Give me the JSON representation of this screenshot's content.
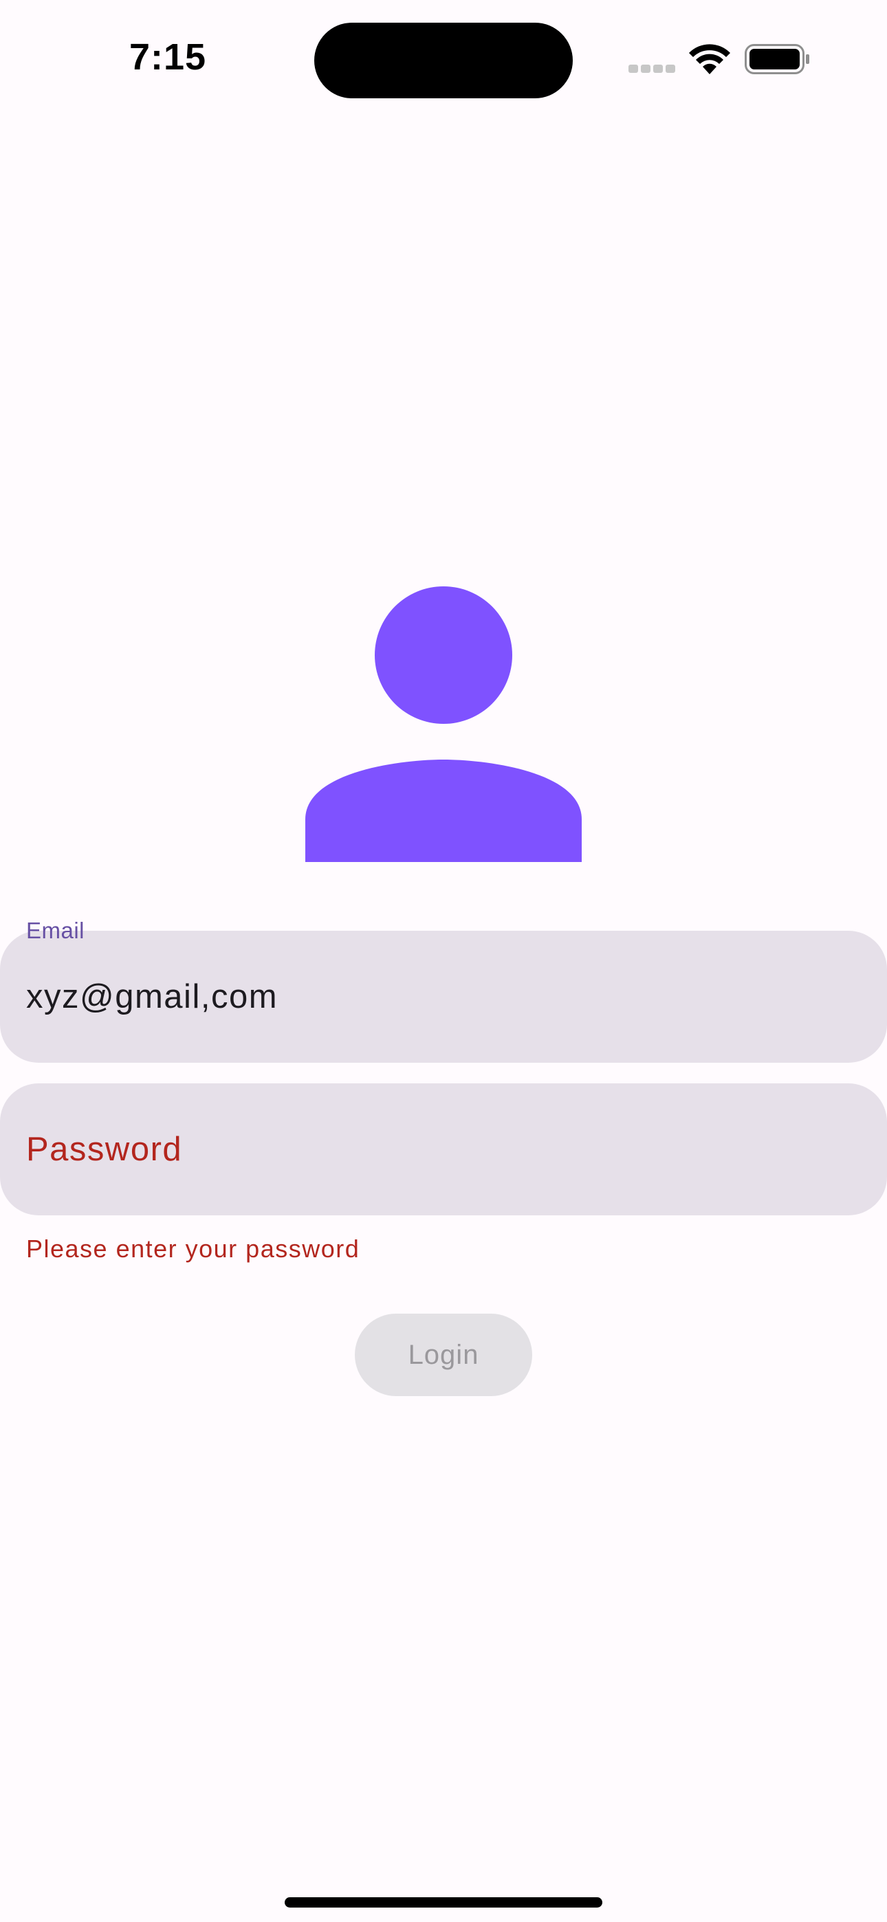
{
  "status_bar": {
    "time": "7:15",
    "signal_icon": "cellular-signal-icon",
    "wifi_icon": "wifi-icon",
    "battery_icon": "battery-icon"
  },
  "avatar": {
    "icon": "person-icon",
    "color": "#7f52ff"
  },
  "login_form": {
    "email": {
      "label": "Email",
      "value": "xyz@gmail,com"
    },
    "password": {
      "placeholder": "Password",
      "error": "Please enter your password"
    },
    "submit_label": "Login"
  },
  "colors": {
    "background": "#fffbfe",
    "field_fill": "#e6e0e9",
    "label_accent": "#6750a4",
    "error": "#b3261e",
    "disabled_button": "#e3e1e5"
  }
}
